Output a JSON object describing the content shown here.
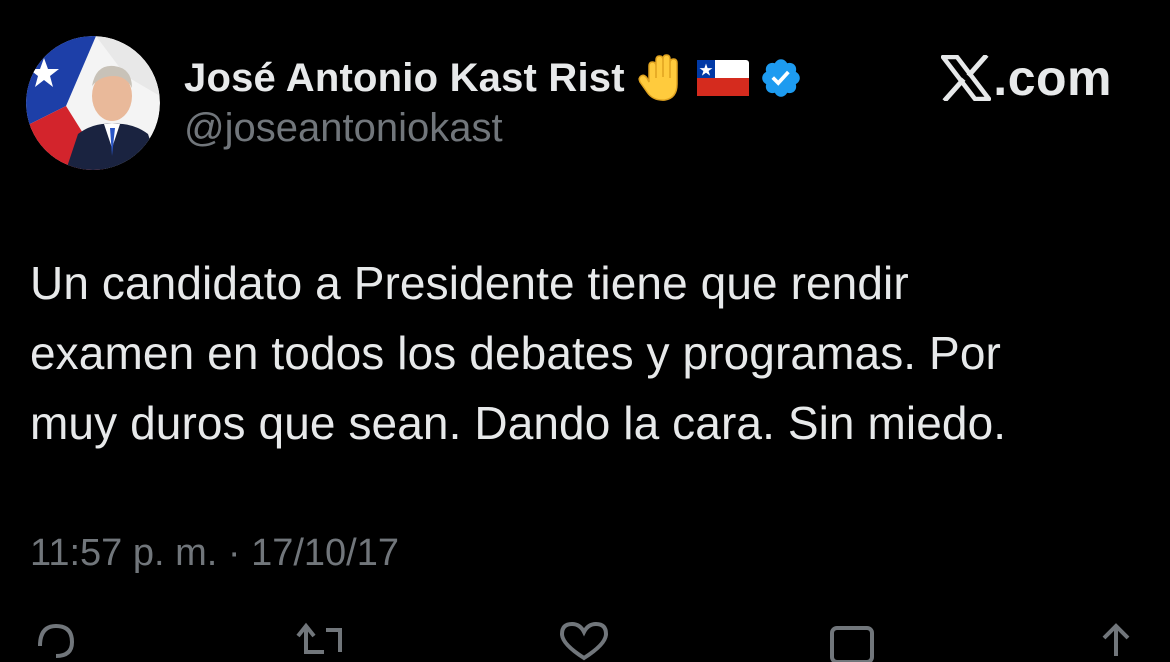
{
  "header": {
    "display_name": "José Antonio Kast Rist",
    "handle": "@joseantoniokast",
    "badges": [
      "raised-hand-emoji",
      "chile-flag-emoji",
      "verified-badge-icon"
    ],
    "brand_suffix": ".com",
    "brand_icon": "x-logo-icon"
  },
  "tweet": {
    "text": "Un candidato a Presidente tiene que rendir\nexamen en todos los debates y programas. Por\nmuy duros que sean. Dando la cara. Sin miedo."
  },
  "meta": {
    "time": "11:57 p. m.",
    "separator": "·",
    "date": "17/10/17"
  },
  "actions": [
    "reply-icon",
    "retweet-icon",
    "like-icon",
    "views-icon",
    "share-icon"
  ],
  "colors": {
    "background": "#000000",
    "text_primary": "#e7e9ea",
    "text_secondary": "#71767b",
    "verified": "#1d9bf0"
  }
}
